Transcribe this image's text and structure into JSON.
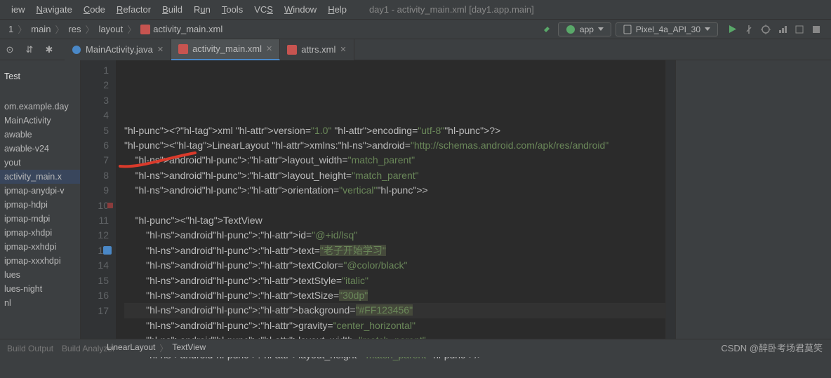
{
  "menu": [
    "iew",
    "Navigate",
    "Code",
    "Refactor",
    "Build",
    "Run",
    "Tools",
    "VCS",
    "Window",
    "Help"
  ],
  "window_title": "day1 - activity_main.xml [day1.app.main]",
  "breadcrumbs": [
    "1",
    "main",
    "res",
    "layout",
    "activity_main.xml"
  ],
  "run_configs": {
    "app": "app",
    "device": "Pixel_4a_API_30"
  },
  "editor_tabs": [
    {
      "label": "MainActivity.java",
      "icon": "java",
      "active": false
    },
    {
      "label": "activity_main.xml",
      "icon": "xml",
      "active": true
    },
    {
      "label": "attrs.xml",
      "icon": "xml",
      "active": false
    }
  ],
  "project": {
    "structure_header": "Test",
    "nodes": [
      "om.example.day",
      "MainActivity",
      "awable",
      "awable-v24",
      "yout",
      "activity_main.x",
      "ipmap-anydpi-v",
      "ipmap-hdpi",
      "ipmap-mdpi",
      "ipmap-xhdpi",
      "ipmap-xxhdpi",
      "ipmap-xxxhdpi",
      "lues",
      "lues-night",
      "nl"
    ],
    "selected": "activity_main.x"
  },
  "code_lines": [
    {
      "n": 1,
      "raw": "<?xml version=\"1.0\" encoding=\"utf-8\"?>"
    },
    {
      "n": 2,
      "raw": "<LinearLayout xmlns:android=\"http://schemas.android.com/apk/res/android\""
    },
    {
      "n": 3,
      "raw": "    android:layout_width=\"match_parent\""
    },
    {
      "n": 4,
      "raw": "    android:layout_height=\"match_parent\""
    },
    {
      "n": 5,
      "raw": "    android:orientation=\"vertical\">"
    },
    {
      "n": 6,
      "raw": ""
    },
    {
      "n": 7,
      "raw": "    <TextView"
    },
    {
      "n": 8,
      "raw": "        android:id=\"@+id/lsq\""
    },
    {
      "n": 9,
      "raw": "        android:text=\"老子开始学习\""
    },
    {
      "n": 10,
      "raw": "        android:textColor=\"@color/black\""
    },
    {
      "n": 11,
      "raw": "        android:textStyle=\"italic\""
    },
    {
      "n": 12,
      "raw": "        android:textSize=\"30dp\""
    },
    {
      "n": 13,
      "raw": "        android:background=\"#FF123456\""
    },
    {
      "n": 14,
      "raw": "        android:gravity=\"center_horizontal\""
    },
    {
      "n": 15,
      "raw": "        android:layout_width=\"match_parent\""
    },
    {
      "n": 16,
      "raw": "        android:layout_height=\"match_parent\"/>"
    },
    {
      "n": 17,
      "raw": ""
    }
  ],
  "current_line": 13,
  "breakpoint_line": 10,
  "structure_breadcrumb": [
    "LinearLayout",
    "TextView"
  ],
  "bottom_tabs": [
    "Build Output",
    "Build Analyzer"
  ],
  "watermark": "CSDN @醉卧考场君莫笑",
  "colors": {
    "accent": "#4a88c7",
    "run": "#59a869",
    "str": "#6a8759",
    "tag": "#e8bf6a"
  }
}
